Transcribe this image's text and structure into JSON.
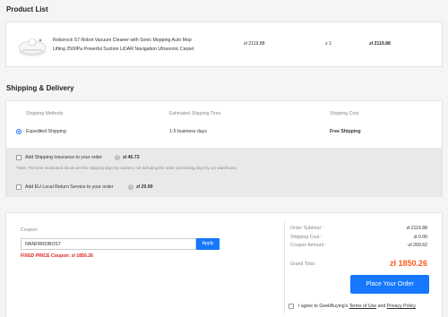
{
  "product_list": {
    "title": "Product List",
    "item": {
      "name_line1": "Roborock S7 Robot Vacuum Cleaner with Sonic Mopping Auto Mop",
      "name_line2": "Lifting 2500Pa Powerful Suction LiDAR Navigation Ultrasonic Carpet",
      "price": "zł 2119.88",
      "qty": "x 1",
      "total": "zł 2119.88"
    }
  },
  "shipping": {
    "title": "Shipping & Delivery",
    "headers": {
      "method": "Shipping Methods",
      "time": "Estimated Shipping Time",
      "cost": "Shipping Cost"
    },
    "option": {
      "method": "Expedited Shipping",
      "time": "1-5 business days",
      "cost": "Free Shipping"
    },
    "insurance": {
      "label": "Add Shipping Insurance to your order",
      "price": "zł 46.73"
    },
    "note": "*Note: The time mentioned above are the shipping days by couriers, not including the order processing days by our warehouse.",
    "return_service": {
      "label": "Add EU Local Return Service to your order",
      "price": "zł 29.99"
    }
  },
  "coupon": {
    "label": "Coupon:",
    "value": "NNNFRROBOS7",
    "apply_label": "Apply",
    "message": "FIXED PRICE Coupon: zł 1850.26"
  },
  "summary": {
    "subtotal_label": "Order Subtotal :",
    "subtotal": "zł 2119.88",
    "shipping_label": "Shipping Cost :",
    "shipping": "zł 0.00",
    "coupon_label": "Coupon Amount :",
    "coupon": "-zł 269.62",
    "grand_label": "Grand Total :",
    "grand": "zł 1850.26",
    "place_order": "Place Your Order",
    "agree_prefix": "I agree to GeekBuying's",
    "terms": "Terms of Use",
    "and": "and",
    "privacy": "Privacy Policy"
  },
  "colors": {
    "accent_orange": "#ff5a1f",
    "button_blue": "#1677ff",
    "error_red": "#e02020"
  }
}
